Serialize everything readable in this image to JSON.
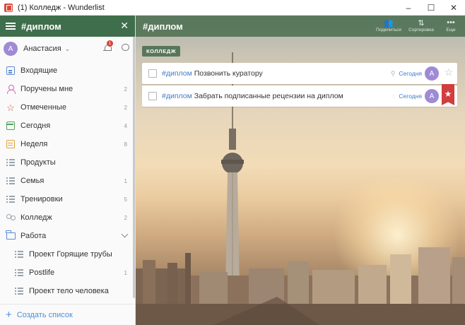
{
  "window": {
    "title": "(1) Колледж - Wunderlist",
    "minimize": "–",
    "maximize": "☐",
    "close": "✕"
  },
  "sidebar": {
    "header_title": "#диплом",
    "close_icon": "✕",
    "user": {
      "initial": "А",
      "name": "Анастасия",
      "chevron": "⌄",
      "notifications": "1"
    },
    "items": [
      {
        "label": "Входящие",
        "count": "",
        "icon": "inbox-icon"
      },
      {
        "label": "Поручены мне",
        "count": "2",
        "icon": "person-icon"
      },
      {
        "label": "Отмеченные",
        "count": "2",
        "icon": "star-icon"
      },
      {
        "label": "Сегодня",
        "count": "4",
        "icon": "calendar-icon"
      },
      {
        "label": "Неделя",
        "count": "8",
        "icon": "week-icon"
      },
      {
        "label": "Продукты",
        "count": "",
        "icon": "list-icon"
      },
      {
        "label": "Семья",
        "count": "1",
        "icon": "list-icon"
      },
      {
        "label": "Тренировки",
        "count": "5",
        "icon": "list-icon"
      },
      {
        "label": "Колледж",
        "count": "2",
        "icon": "shared-list-icon"
      },
      {
        "label": "Работа",
        "count": "",
        "icon": "folder-icon"
      },
      {
        "label": "Проект Горящие трубы",
        "count": "",
        "icon": "list-icon"
      },
      {
        "label": "Postlife",
        "count": "1",
        "icon": "list-icon"
      },
      {
        "label": "Проект тело человека",
        "count": "",
        "icon": "list-icon"
      }
    ],
    "create_list": "Создать список"
  },
  "main": {
    "title": "#диплом",
    "toolbar": {
      "share": "Поделиться",
      "sort": "Сортировка",
      "more": "Еще"
    },
    "section": "КОЛЛЕДЖ",
    "tasks": [
      {
        "tag": "#диплом",
        "text": "Позвонить куратору",
        "due": "Сегодня",
        "assignee": "А",
        "starred": false
      },
      {
        "tag": "#диплом",
        "text": "Забрать подписанные рецензии на диплом",
        "due": "Сегодня",
        "assignee": "А",
        "starred": true
      }
    ]
  },
  "colors": {
    "accent_green": "#3f6e4c",
    "link_blue": "#3f7bc9",
    "star_red": "#d23d3d",
    "avatar": "#9f8ad6"
  }
}
